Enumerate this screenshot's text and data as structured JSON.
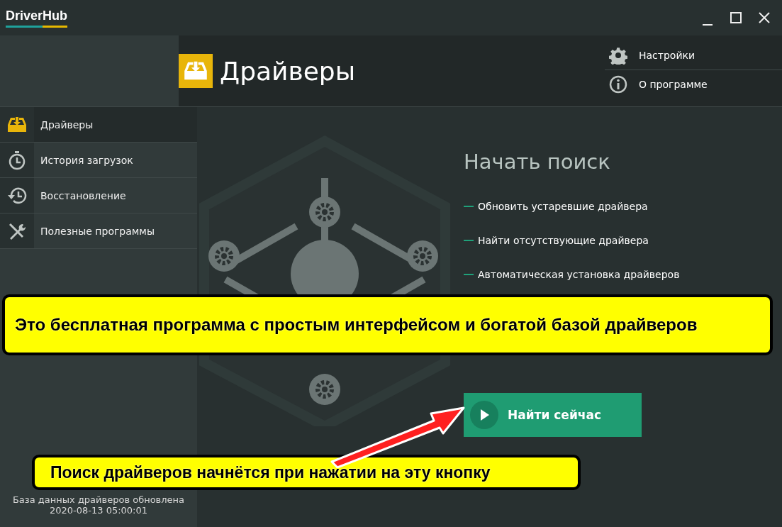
{
  "window": {
    "logo": "DriverHub"
  },
  "header": {
    "title": "Драйверы",
    "menu": [
      {
        "label": "Настройки",
        "kind": "gear"
      },
      {
        "label": "О программе",
        "kind": "info"
      }
    ]
  },
  "sidebar": {
    "items": [
      {
        "label": "Драйверы",
        "kind": "drivers",
        "selected": true
      },
      {
        "label": "История загрузок",
        "kind": "clock",
        "selected": false
      },
      {
        "label": "Восстановление",
        "kind": "restore",
        "selected": false
      },
      {
        "label": "Полезные программы",
        "kind": "tools",
        "selected": false
      }
    ],
    "footer": [
      "База данных драйверов обновлена",
      "2020-08-13 05:00:01"
    ]
  },
  "main": {
    "heading": "Начать поиск",
    "features": [
      "Обновить устаревшие драйвера",
      "Найти отсутствующие драйвера",
      "Автоматическая установка драйверов"
    ],
    "button": "Найти сейчас"
  },
  "callouts": [
    {
      "kind": "top",
      "text": "Это бесплатная программа с простым интерфейсом и богатой базой драйверов"
    },
    {
      "kind": "bottom",
      "text": "Поиск драйверов начнётся при нажатии на эту кнопку"
    }
  ]
}
